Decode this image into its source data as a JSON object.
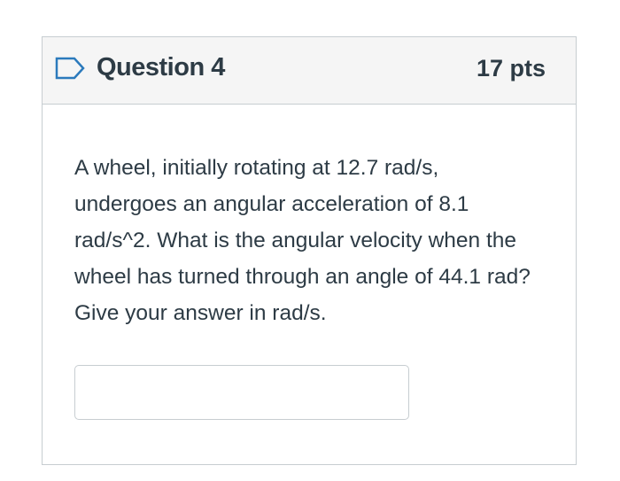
{
  "question": {
    "title": "Question 4",
    "points": "17 pts",
    "text": "A wheel, initially rotating at 12.7 rad/s, undergoes an angular acceleration of 8.1 rad/s^2. What is the angular velocity when the wheel has turned through an angle of 44.1 rad? Give your answer in rad/s.",
    "flag_icon": "flag-outline-icon",
    "answer": {
      "value": "",
      "placeholder": ""
    }
  },
  "colors": {
    "header_bg": "#f5f5f5",
    "border": "#c7cdd1",
    "text": "#2d3b45",
    "flag": "#2b7abc"
  }
}
